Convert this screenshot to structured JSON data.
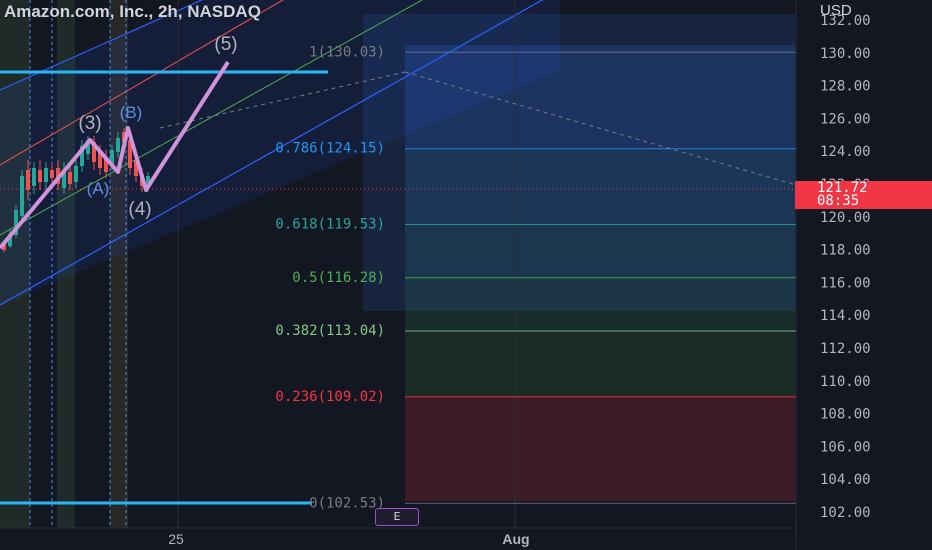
{
  "header": {
    "title": "Amazon.com, Inc., 2h, NASDAQ",
    "currency": "USD"
  },
  "price_axis": {
    "ticks": [
      "132.00",
      "130.00",
      "128.00",
      "126.00",
      "124.00",
      "122.00",
      "120.00",
      "118.00",
      "116.00",
      "114.00",
      "112.00",
      "110.00",
      "108.00",
      "106.00",
      "104.00",
      "102.00"
    ],
    "tick_values": [
      132,
      130,
      128,
      126,
      124,
      122,
      120,
      118,
      116,
      114,
      112,
      110,
      108,
      106,
      104,
      102
    ]
  },
  "last_price": {
    "value": "121.72",
    "countdown": "08:35",
    "color": "#f23645"
  },
  "time_axis": {
    "labels": [
      "25",
      "Aug"
    ]
  },
  "fib_levels": [
    {
      "label": "1(130.03)",
      "value": 130.03,
      "color": "#787b86"
    },
    {
      "label": "0.786(124.15)",
      "value": 124.15,
      "color": "#2196f3"
    },
    {
      "label": "0.618(119.53)",
      "value": 119.53,
      "color": "#26a69a"
    },
    {
      "label": "0.5(116.28)",
      "value": 116.28,
      "color": "#4caf50"
    },
    {
      "label": "0.382(113.04)",
      "value": 113.04,
      "color": "#81c784"
    },
    {
      "label": "0.236(109.02)",
      "value": 109.02,
      "color": "#f23645"
    },
    {
      "label": "0(102.53)",
      "value": 102.53,
      "color": "#787b86"
    }
  ],
  "wave_labels": [
    "(5)",
    "(3)",
    "(B)",
    "(A)",
    "(4)"
  ],
  "e_button": "E",
  "colors": {
    "background": "#131722",
    "wave_line": "#ce93d8",
    "channel": "#2962ff",
    "up_candle": "#26a69a",
    "down_candle": "#ef5350"
  }
}
